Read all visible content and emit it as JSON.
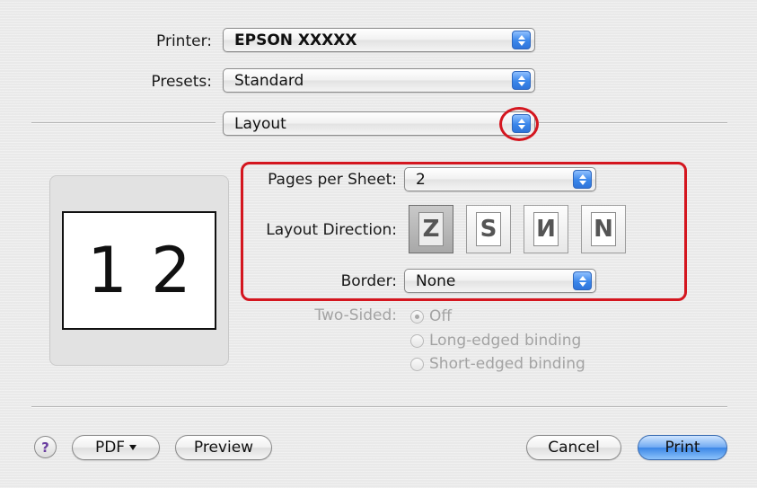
{
  "printer": {
    "label": "Printer:",
    "value": "EPSON XXXXX"
  },
  "presets": {
    "label": "Presets:",
    "value": "Standard"
  },
  "panel": {
    "value": "Layout"
  },
  "preview": {
    "page1": "1",
    "page2": "2"
  },
  "layout": {
    "pages_per_sheet": {
      "label": "Pages per Sheet:",
      "value": "2"
    },
    "direction": {
      "label": "Layout Direction:",
      "options": [
        {
          "icon": "z-order-icon",
          "glyph": "Z",
          "selected": true
        },
        {
          "icon": "reverse-z-order-icon",
          "glyph": "S",
          "selected": false
        },
        {
          "icon": "n-order-icon",
          "glyph": "И",
          "selected": false
        },
        {
          "icon": "reverse-n-order-icon",
          "glyph": "N",
          "selected": false
        }
      ]
    },
    "border": {
      "label": "Border:",
      "value": "None"
    }
  },
  "two_sided": {
    "label": "Two-Sided:",
    "options": [
      {
        "label": "Off",
        "selected": true
      },
      {
        "label": "Long-edged binding",
        "selected": false
      },
      {
        "label": "Short-edged binding",
        "selected": false
      }
    ]
  },
  "footer": {
    "help_glyph": "?",
    "pdf_label": "PDF",
    "preview_label": "Preview",
    "cancel_label": "Cancel",
    "print_label": "Print"
  },
  "colors": {
    "highlight": "#d4161f",
    "accent": "#3b86e6"
  }
}
